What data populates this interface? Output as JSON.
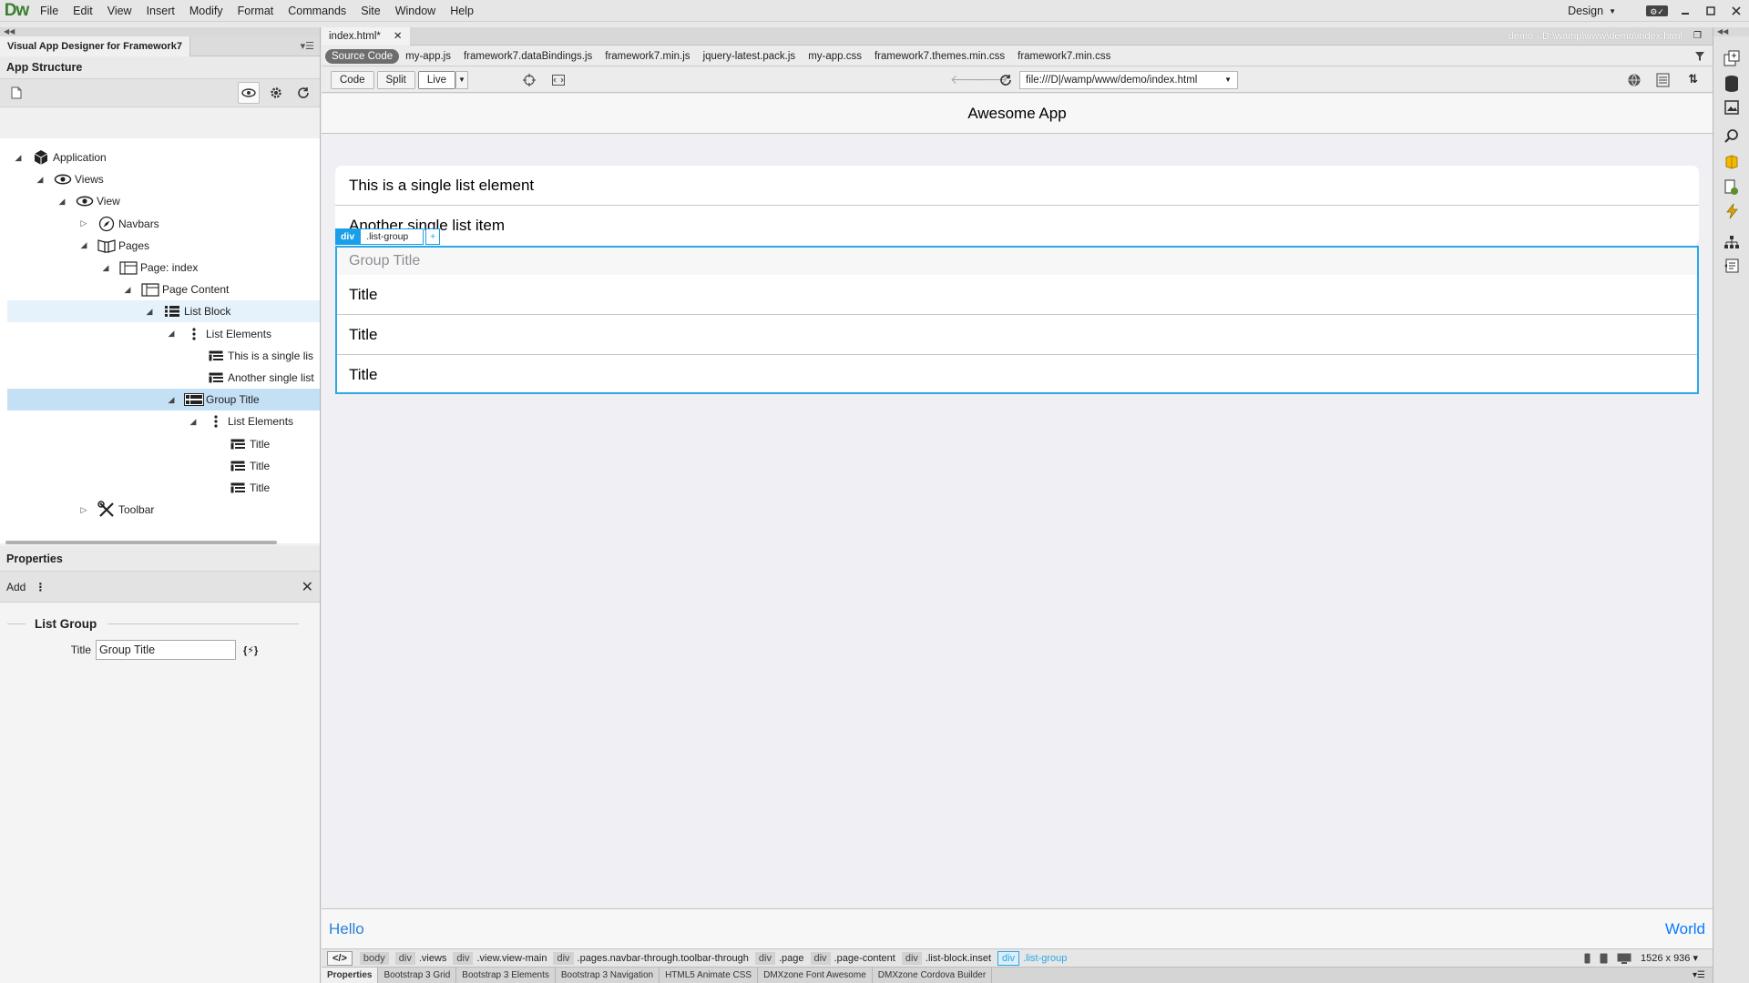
{
  "menubar": {
    "logo": "Dw",
    "items": [
      "File",
      "Edit",
      "View",
      "Insert",
      "Modify",
      "Format",
      "Commands",
      "Site",
      "Window",
      "Help"
    ],
    "workspace": "Design"
  },
  "left_panel": {
    "tab": "Visual App Designer for Framework7",
    "structure_title": "App Structure",
    "tree": [
      {
        "label": "Application",
        "level": 0
      },
      {
        "label": "Views",
        "level": 1
      },
      {
        "label": "View",
        "level": 2
      },
      {
        "label": "Navbars",
        "level": 3
      },
      {
        "label": "Pages",
        "level": 3
      },
      {
        "label": "Page: index",
        "level": 4
      },
      {
        "label": "Page Content",
        "level": 5
      },
      {
        "label": "List Block",
        "level": 6
      },
      {
        "label": "List Elements",
        "level": 7
      },
      {
        "label": "This is a single lis",
        "level": 8
      },
      {
        "label": "Another single list",
        "level": 8
      },
      {
        "label": "Group Title",
        "level": 7
      },
      {
        "label": "List Elements",
        "level": 8
      },
      {
        "label": "Title",
        "level": 9
      },
      {
        "label": "Title",
        "level": 9
      },
      {
        "label": "Title",
        "level": 9
      },
      {
        "label": "Toolbar",
        "level": 3
      }
    ],
    "properties_title": "Properties",
    "add_label": "Add",
    "group_name": "List Group",
    "title_label": "Title",
    "title_value": "Group Title",
    "bind_label": "{⚡}"
  },
  "document": {
    "tab_name": "index.html*",
    "path": "demo - D:\\wamp\\www\\demo\\index.html",
    "related_files": [
      "Source Code",
      "my-app.js",
      "framework7.dataBindings.js",
      "framework7.min.js",
      "jquery-latest.pack.js",
      "my-app.css",
      "framework7.themes.min.css",
      "framework7.min.css"
    ],
    "view_buttons": [
      "Code",
      "Split",
      "Live"
    ],
    "url": "file:///D|/wamp/www/demo/index.html"
  },
  "app": {
    "navbar_title": "Awesome App",
    "list_items": [
      "This is a single list element",
      "Another single list item"
    ],
    "group_title": "Group Title",
    "group_items": [
      "Title",
      "Title",
      "Title"
    ],
    "selection_tag": "div",
    "selection_class": ".list-group",
    "toolbar_left": "Hello",
    "toolbar_right": "World"
  },
  "tagbar": {
    "code_label": "</>",
    "crumbs": [
      {
        "tag": "body",
        "cls": ""
      },
      {
        "tag": "div",
        "cls": ".views"
      },
      {
        "tag": "div",
        "cls": ".view.view-main"
      },
      {
        "tag": "div",
        "cls": ".pages.navbar-through.toolbar-through"
      },
      {
        "tag": "div",
        "cls": ".page"
      },
      {
        "tag": "div",
        "cls": ".page-content"
      },
      {
        "tag": "div",
        "cls": ".list-block.inset"
      },
      {
        "tag": "div",
        "cls": ".list-group"
      }
    ],
    "size": "1526 x 936"
  },
  "bottom_tabs": [
    "Properties",
    "Bootstrap 3 Grid",
    "Bootstrap 3 Elements",
    "Bootstrap 3 Navigation",
    "HTML5 Animate CSS",
    "DMXzone Font Awesome",
    "DMXzone Cordova Builder"
  ],
  "colors": {
    "accent": "#2ba8e6",
    "selected_row": "#c4e0f5",
    "link": "#0a7aff"
  }
}
